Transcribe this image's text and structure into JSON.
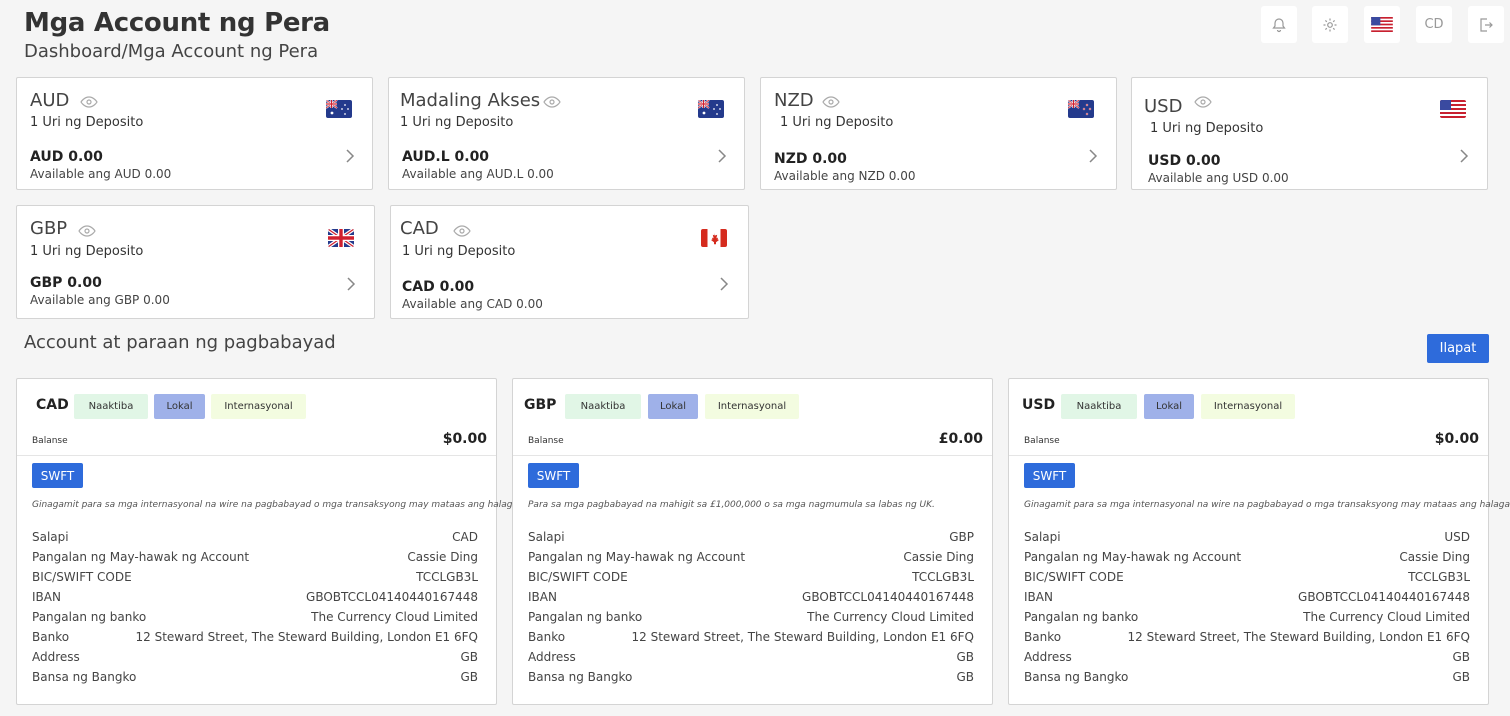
{
  "header": {
    "title": "Mga Account ng Pera",
    "breadcrumb": "Dashboard/Mga Account ng Pera",
    "user_initials": "CD"
  },
  "accounts": [
    {
      "currency": "AUD",
      "types": "1 Uri ng Deposito",
      "balance": "AUD 0.00",
      "available": "Available ang AUD 0.00",
      "flag": "australia-flag-icon"
    },
    {
      "currency": "Madaling Akses",
      "types": "1 Uri ng Deposito",
      "balance": "AUD.L 0.00",
      "available": "Available ang AUD.L 0.00",
      "flag": "australia-flag-icon"
    },
    {
      "currency": "NZD",
      "types": "1 Uri ng Deposito",
      "balance": "NZD 0.00",
      "available": "Available ang NZD 0.00",
      "flag": "new-zealand-flag-icon"
    },
    {
      "currency": "USD",
      "types": "1 Uri ng Deposito",
      "balance": "USD 0.00",
      "available": "Available ang USD 0.00",
      "flag": "usa-flag-icon"
    },
    {
      "currency": "GBP",
      "types": "1 Uri ng Deposito",
      "balance": "GBP 0.00",
      "available": "Available ang GBP 0.00",
      "flag": "uk-flag-icon"
    },
    {
      "currency": "CAD",
      "types": "1 Uri ng Deposito",
      "balance": "CAD 0.00",
      "available": "Available ang CAD 0.00",
      "flag": "canada-flag-icon"
    }
  ],
  "payment_section": {
    "title": "Account at paraan ng pagbabayad",
    "add_label": "Ilapat"
  },
  "payment_cards": [
    {
      "currency": "CAD",
      "tags": [
        "Naaktiba",
        "Lokal",
        "Internasyonal"
      ],
      "balance_label": "Balanse",
      "amount": "$0.00",
      "method": "SWFT",
      "description": "Ginagamit para sa mga internasyonal na wire na pagbabayad o mga transaksyong may mataas ang halaga.",
      "rows": [
        {
          "label": "Salapi",
          "value": "CAD"
        },
        {
          "label": "Pangalan ng May-hawak ng Account",
          "value": "Cassie Ding"
        },
        {
          "label": "BIC/SWIFT CODE",
          "value": "TCCLGB3L"
        },
        {
          "label": "IBAN",
          "value": "GBOBTCCL04140440167448"
        },
        {
          "label": "Pangalan ng banko",
          "value": "The Currency Cloud Limited"
        },
        {
          "label": "Banko",
          "value": "12 Steward Street, The Steward Building, London E1 6FQ"
        },
        {
          "label": "Address",
          "value": "GB"
        },
        {
          "label": "Bansa ng Bangko",
          "value": "GB"
        }
      ]
    },
    {
      "currency": "GBP",
      "tags": [
        "Naaktiba",
        "Lokal",
        "Internasyonal"
      ],
      "balance_label": "Balanse",
      "amount": "£0.00",
      "method": "SWFT",
      "description": "Para sa mga pagbabayad na mahigit sa £1,000,000 o sa mga nagmumula sa labas ng UK.",
      "rows": [
        {
          "label": "Salapi",
          "value": "GBP"
        },
        {
          "label": "Pangalan ng May-hawak ng Account",
          "value": "Cassie Ding"
        },
        {
          "label": "BIC/SWIFT CODE",
          "value": "TCCLGB3L"
        },
        {
          "label": "IBAN",
          "value": "GBOBTCCL04140440167448"
        },
        {
          "label": "Pangalan ng banko",
          "value": "The Currency Cloud Limited"
        },
        {
          "label": "Banko",
          "value": "12 Steward Street, The Steward Building, London E1 6FQ"
        },
        {
          "label": "Address",
          "value": "GB"
        },
        {
          "label": "Bansa ng Bangko",
          "value": "GB"
        }
      ]
    },
    {
      "currency": "USD",
      "tags": [
        "Naaktiba",
        "Lokal",
        "Internasyonal"
      ],
      "balance_label": "Balanse",
      "amount": "$0.00",
      "method": "SWFT",
      "description": "Ginagamit para sa mga internasyonal na wire na pagbabayad o mga transaksyong may mataas ang halaga.",
      "rows": [
        {
          "label": "Salapi",
          "value": "USD"
        },
        {
          "label": "Pangalan ng May-hawak ng Account",
          "value": "Cassie Ding"
        },
        {
          "label": "BIC/SWIFT CODE",
          "value": "TCCLGB3L"
        },
        {
          "label": "IBAN",
          "value": "GBOBTCCL04140440167448"
        },
        {
          "label": "Pangalan ng banko",
          "value": "The Currency Cloud Limited"
        },
        {
          "label": "Banko",
          "value": "12 Steward Street, The Steward Building, London E1 6FQ"
        },
        {
          "label": "Address",
          "value": "GB"
        },
        {
          "label": "Bansa ng Bangko",
          "value": "GB"
        }
      ]
    }
  ]
}
